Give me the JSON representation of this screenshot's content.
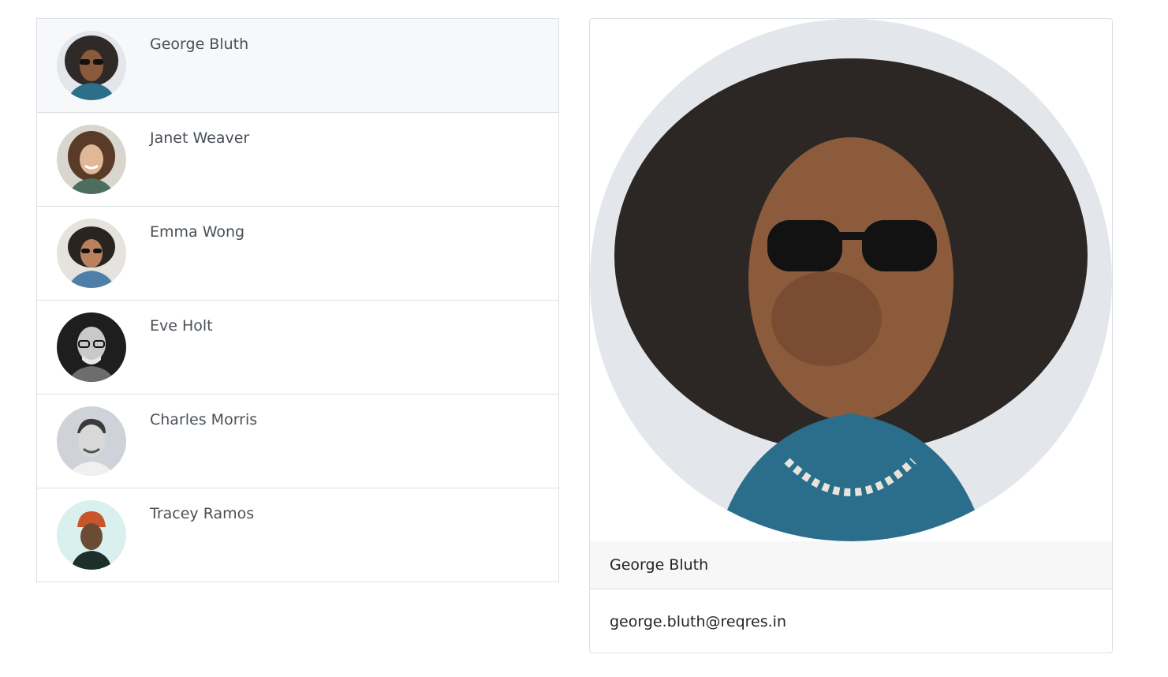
{
  "users": [
    {
      "name": "George Bluth",
      "active": true,
      "avatar_icon": "person-curly-hair-sunglasses-avatar"
    },
    {
      "name": "Janet Weaver",
      "active": false,
      "avatar_icon": "person-smiling-curly-hair-avatar"
    },
    {
      "name": "Emma Wong",
      "active": false,
      "avatar_icon": "person-curly-hair-sunglasses-jacket-avatar"
    },
    {
      "name": "Eve Holt",
      "active": false,
      "avatar_icon": "person-bald-glasses-bw-avatar"
    },
    {
      "name": "Charles Morris",
      "active": false,
      "avatar_icon": "person-smiling-short-hair-avatar"
    },
    {
      "name": "Tracey Ramos",
      "active": false,
      "avatar_icon": "person-orange-beanie-avatar"
    }
  ],
  "selected": {
    "name": "George Bluth",
    "email": "george.bluth@reqres.in",
    "portrait_icon": "person-curly-hair-sunglasses-portrait"
  },
  "colors": {
    "border": "#dcdfe3",
    "active_row": "#f7f8fa",
    "card_header": "#f7f7f7",
    "text_muted": "#495057"
  }
}
